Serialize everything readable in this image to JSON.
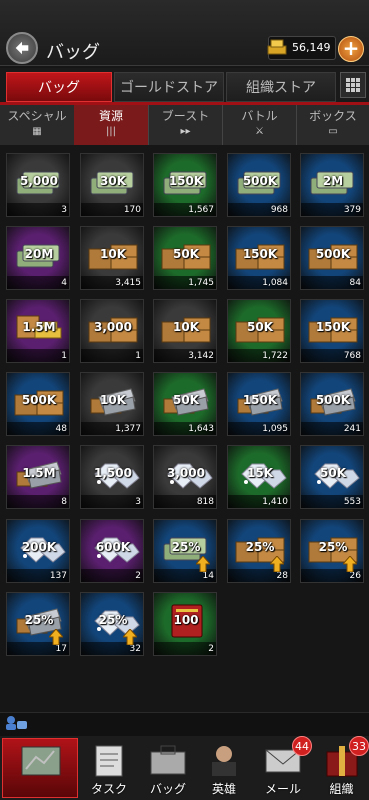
{
  "header": {
    "title": "バッグ",
    "gold": "56,149",
    "add_label": "+"
  },
  "main_tabs": [
    "バッグ",
    "ゴールドストア",
    "組織ストア"
  ],
  "sub_tabs": [
    {
      "label": "スペシャル",
      "icon": "grid-icon"
    },
    {
      "label": "資源",
      "icon": "bars-icon"
    },
    {
      "label": "ブースト",
      "icon": "fast-forward-icon"
    },
    {
      "label": "バトル",
      "icon": "sword-icon"
    },
    {
      "label": "ボックス",
      "icon": "box-icon"
    }
  ],
  "items": [
    {
      "label": "5,000",
      "count": "3",
      "bg": "gray",
      "type": "cash"
    },
    {
      "label": "30K",
      "count": "170",
      "bg": "gray",
      "type": "cash"
    },
    {
      "label": "150K",
      "count": "1,567",
      "bg": "green",
      "type": "cash"
    },
    {
      "label": "500K",
      "count": "968",
      "bg": "blue",
      "type": "cash"
    },
    {
      "label": "2M",
      "count": "379",
      "bg": "blue",
      "type": "cash"
    },
    {
      "label": "20M",
      "count": "4",
      "bg": "purple",
      "type": "cash"
    },
    {
      "label": "10K",
      "count": "3,415",
      "bg": "gray",
      "type": "crate"
    },
    {
      "label": "50K",
      "count": "1,745",
      "bg": "green",
      "type": "crate"
    },
    {
      "label": "150K",
      "count": "1,084",
      "bg": "blue",
      "type": "crate"
    },
    {
      "label": "500K",
      "count": "84",
      "bg": "blue",
      "type": "crate"
    },
    {
      "label": "1.5M",
      "count": "1",
      "bg": "purple",
      "type": "gold"
    },
    {
      "label": "3,000",
      "count": "1",
      "bg": "gray",
      "type": "crate"
    },
    {
      "label": "10K",
      "count": "3,142",
      "bg": "gray",
      "type": "crate"
    },
    {
      "label": "50K",
      "count": "1,722",
      "bg": "green",
      "type": "crate"
    },
    {
      "label": "150K",
      "count": "768",
      "bg": "blue",
      "type": "crate"
    },
    {
      "label": "500K",
      "count": "48",
      "bg": "blue",
      "type": "crate"
    },
    {
      "label": "10K",
      "count": "1,377",
      "bg": "gray",
      "type": "metal"
    },
    {
      "label": "50K",
      "count": "1,643",
      "bg": "green",
      "type": "metal"
    },
    {
      "label": "150K",
      "count": "1,095",
      "bg": "blue",
      "type": "metal"
    },
    {
      "label": "500K",
      "count": "241",
      "bg": "blue",
      "type": "metal"
    },
    {
      "label": "1.5M",
      "count": "8",
      "bg": "purple",
      "type": "metal"
    },
    {
      "label": "1,500",
      "count": "3",
      "bg": "gray",
      "type": "diamond"
    },
    {
      "label": "3,000",
      "count": "818",
      "bg": "gray",
      "type": "diamond"
    },
    {
      "label": "15K",
      "count": "1,410",
      "bg": "green",
      "type": "diamond"
    },
    {
      "label": "50K",
      "count": "553",
      "bg": "blue",
      "type": "diamond"
    },
    {
      "label": "200K",
      "count": "137",
      "bg": "blue",
      "type": "diamond"
    },
    {
      "label": "600K",
      "count": "2",
      "bg": "purple",
      "type": "diamond"
    },
    {
      "label": "25%",
      "count": "14",
      "bg": "blue",
      "type": "cash-boost"
    },
    {
      "label": "25%",
      "count": "28",
      "bg": "blue",
      "type": "crate-boost"
    },
    {
      "label": "25%",
      "count": "26",
      "bg": "blue",
      "type": "crate-boost"
    },
    {
      "label": "25%",
      "count": "17",
      "bg": "blue",
      "type": "metal-boost"
    },
    {
      "label": "25%",
      "count": "32",
      "bg": "blue",
      "type": "diamond-boost"
    },
    {
      "label": "100",
      "count": "2",
      "bg": "green",
      "type": "book"
    }
  ],
  "bottom_nav": [
    {
      "label": "",
      "icon": "map-icon",
      "badge": ""
    },
    {
      "label": "タスク",
      "icon": "task-icon",
      "badge": ""
    },
    {
      "label": "バッグ",
      "icon": "bag-icon",
      "badge": ""
    },
    {
      "label": "英雄",
      "icon": "hero-icon",
      "badge": ""
    },
    {
      "label": "メール",
      "icon": "mail-icon",
      "badge": "44"
    },
    {
      "label": "組織",
      "icon": "organization-icon",
      "badge": "33"
    }
  ],
  "colors": {
    "gray": "#3a3a3a",
    "green": "#1d6b2a",
    "blue": "#12457a",
    "purple": "#5a1f6e",
    "accent": "#c0161a"
  }
}
